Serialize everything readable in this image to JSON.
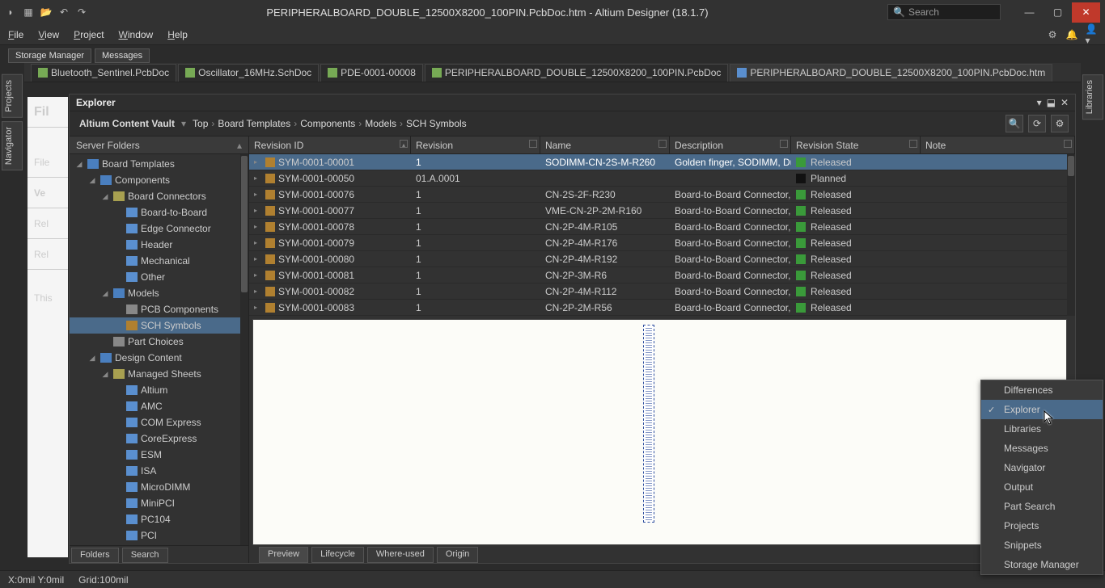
{
  "titlebar": {
    "title": "PERIPHERALBOARD_DOUBLE_12500X8200_100PIN.PcbDoc.htm - Altium Designer (18.1.7)",
    "search_placeholder": "Search"
  },
  "menubar": {
    "items": [
      "File",
      "View",
      "Project",
      "Window",
      "Help"
    ]
  },
  "subtabs": [
    "Storage Manager",
    "Messages"
  ],
  "doctabs": [
    {
      "label": "Bluetooth_Sentinel.PcbDoc",
      "icon": "brown"
    },
    {
      "label": "Oscillator_16MHz.SchDoc",
      "icon": "brown"
    },
    {
      "label": "PDE-0001-00008",
      "icon": "brown"
    },
    {
      "label": "PERIPHERALBOARD_DOUBLE_12500X8200_100PIN.PcbDoc",
      "icon": "brown"
    },
    {
      "label": "PERIPHERALBOARD_DOUBLE_12500X8200_100PIN.PcbDoc.htm",
      "icon": "doc",
      "active": true
    }
  ],
  "side_left": [
    "Projects",
    "Navigator"
  ],
  "side_right": [
    "Libraries"
  ],
  "bg_panel": {
    "header": "Fil",
    "rows": [
      "File",
      "Ve",
      "Rel",
      "Rel",
      "This"
    ]
  },
  "explorer": {
    "title": "Explorer",
    "breadcrumb_root": "Altium Content Vault",
    "breadcrumb": [
      "Top",
      "Board Templates",
      "Components",
      "Models",
      "SCH Symbols"
    ],
    "tree_header": "Server Folders",
    "tree": [
      {
        "label": "Board Templates",
        "depth": 0,
        "icon": "folder-open",
        "expanded": true
      },
      {
        "label": "Components",
        "depth": 1,
        "icon": "folder-open",
        "expanded": true
      },
      {
        "label": "Board Connectors",
        "depth": 2,
        "icon": "comp",
        "expanded": true
      },
      {
        "label": "Board-to-Board",
        "depth": 3,
        "icon": "folder"
      },
      {
        "label": "Edge Connector",
        "depth": 3,
        "icon": "folder"
      },
      {
        "label": "Header",
        "depth": 3,
        "icon": "folder"
      },
      {
        "label": "Mechanical",
        "depth": 3,
        "icon": "folder"
      },
      {
        "label": "Other",
        "depth": 3,
        "icon": "folder"
      },
      {
        "label": "Models",
        "depth": 2,
        "icon": "folder-open",
        "expanded": true
      },
      {
        "label": "PCB Components",
        "depth": 3,
        "icon": "other"
      },
      {
        "label": "SCH Symbols",
        "depth": 3,
        "icon": "sym",
        "selected": true
      },
      {
        "label": "Part Choices",
        "depth": 2,
        "icon": "other"
      },
      {
        "label": "Design Content",
        "depth": 1,
        "icon": "folder-open",
        "expanded": true
      },
      {
        "label": "Managed Sheets",
        "depth": 2,
        "icon": "comp",
        "expanded": true
      },
      {
        "label": "Altium",
        "depth": 3,
        "icon": "folder"
      },
      {
        "label": "AMC",
        "depth": 3,
        "icon": "folder"
      },
      {
        "label": "COM Express",
        "depth": 3,
        "icon": "folder"
      },
      {
        "label": "CoreExpress",
        "depth": 3,
        "icon": "folder"
      },
      {
        "label": "ESM",
        "depth": 3,
        "icon": "folder"
      },
      {
        "label": "ISA",
        "depth": 3,
        "icon": "folder"
      },
      {
        "label": "MicroDIMM",
        "depth": 3,
        "icon": "folder"
      },
      {
        "label": "MiniPCI",
        "depth": 3,
        "icon": "folder"
      },
      {
        "label": "PC104",
        "depth": 3,
        "icon": "folder"
      },
      {
        "label": "PCI",
        "depth": 3,
        "icon": "folder"
      }
    ],
    "tree_footer": [
      "Folders",
      "Search"
    ],
    "columns": [
      "Revision ID",
      "Revision",
      "Name",
      "Description",
      "Revision State",
      "Note"
    ],
    "rows": [
      {
        "id": "SYM-0001-00001",
        "rev": "1",
        "name": "SODIMM-CN-2S-M-R260",
        "desc": "Golden finger, SODIMM, Du...",
        "state": "Released",
        "color": "#3a9a3a",
        "selected": true
      },
      {
        "id": "SYM-0001-00050",
        "rev": "01.A.0001",
        "name": "",
        "desc": "",
        "state": "Planned",
        "color": "#111"
      },
      {
        "id": "SYM-0001-00076",
        "rev": "1",
        "name": "CN-2S-2F-R230",
        "desc": "Board-to-Board Connector,...",
        "state": "Released",
        "color": "#3a9a3a"
      },
      {
        "id": "SYM-0001-00077",
        "rev": "1",
        "name": "VME-CN-2P-2M-R160",
        "desc": "Board-to-Board Connector,...",
        "state": "Released",
        "color": "#3a9a3a"
      },
      {
        "id": "SYM-0001-00078",
        "rev": "1",
        "name": "CN-2P-4M-R105",
        "desc": "Board-to-Board Connector,...",
        "state": "Released",
        "color": "#3a9a3a"
      },
      {
        "id": "SYM-0001-00079",
        "rev": "1",
        "name": "CN-2P-4M-R176",
        "desc": "Board-to-Board Connector,...",
        "state": "Released",
        "color": "#3a9a3a"
      },
      {
        "id": "SYM-0001-00080",
        "rev": "1",
        "name": "CN-2P-4M-R192",
        "desc": "Board-to-Board Connector,...",
        "state": "Released",
        "color": "#3a9a3a"
      },
      {
        "id": "SYM-0001-00081",
        "rev": "1",
        "name": "CN-2P-3M-R6",
        "desc": "Board-to-Board Connector,...",
        "state": "Released",
        "color": "#3a9a3a"
      },
      {
        "id": "SYM-0001-00082",
        "rev": "1",
        "name": "CN-2P-4M-R112",
        "desc": "Board-to-Board Connector,...",
        "state": "Released",
        "color": "#3a9a3a"
      },
      {
        "id": "SYM-0001-00083",
        "rev": "1",
        "name": "CN-2P-2M-R56",
        "desc": "Board-to-Board Connector,...",
        "state": "Released",
        "color": "#3a9a3a"
      }
    ],
    "preview_tabs": [
      "Preview",
      "Lifecycle",
      "Where-used",
      "Origin"
    ]
  },
  "context_menu": [
    "Differences",
    "Explorer",
    "Libraries",
    "Messages",
    "Navigator",
    "Output",
    "Part Search",
    "Projects",
    "Snippets",
    "Storage Manager"
  ],
  "context_menu_selected": 1,
  "statusbar": {
    "coords": "X:0mil Y:0mil",
    "grid": "Grid:100mil"
  }
}
